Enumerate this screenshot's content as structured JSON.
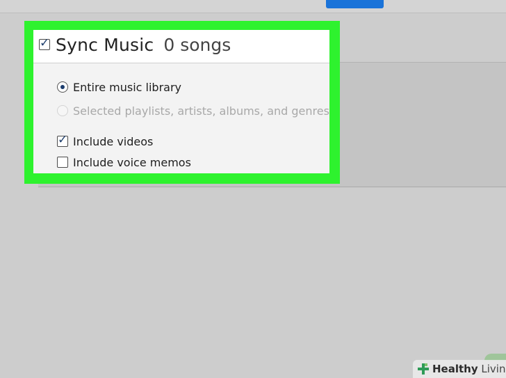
{
  "sync_music": {
    "title": "Sync Music",
    "count": "0 songs",
    "checked": true,
    "options": {
      "entire_library": "Entire music library",
      "selected": "Selected playlists, artists, albums, and genres"
    },
    "include_videos": {
      "label": "Include videos",
      "checked": true
    },
    "include_voice_memos": {
      "label": "Include voice memos",
      "checked": false
    }
  },
  "watermark": {
    "brand_bold": "Healthy",
    "brand_light": " Living",
    "icon": "plus-cross-icon"
  },
  "colors": {
    "highlight": "#2ef22e",
    "accent": "#1a73d9",
    "background": "#cdcdcd"
  }
}
